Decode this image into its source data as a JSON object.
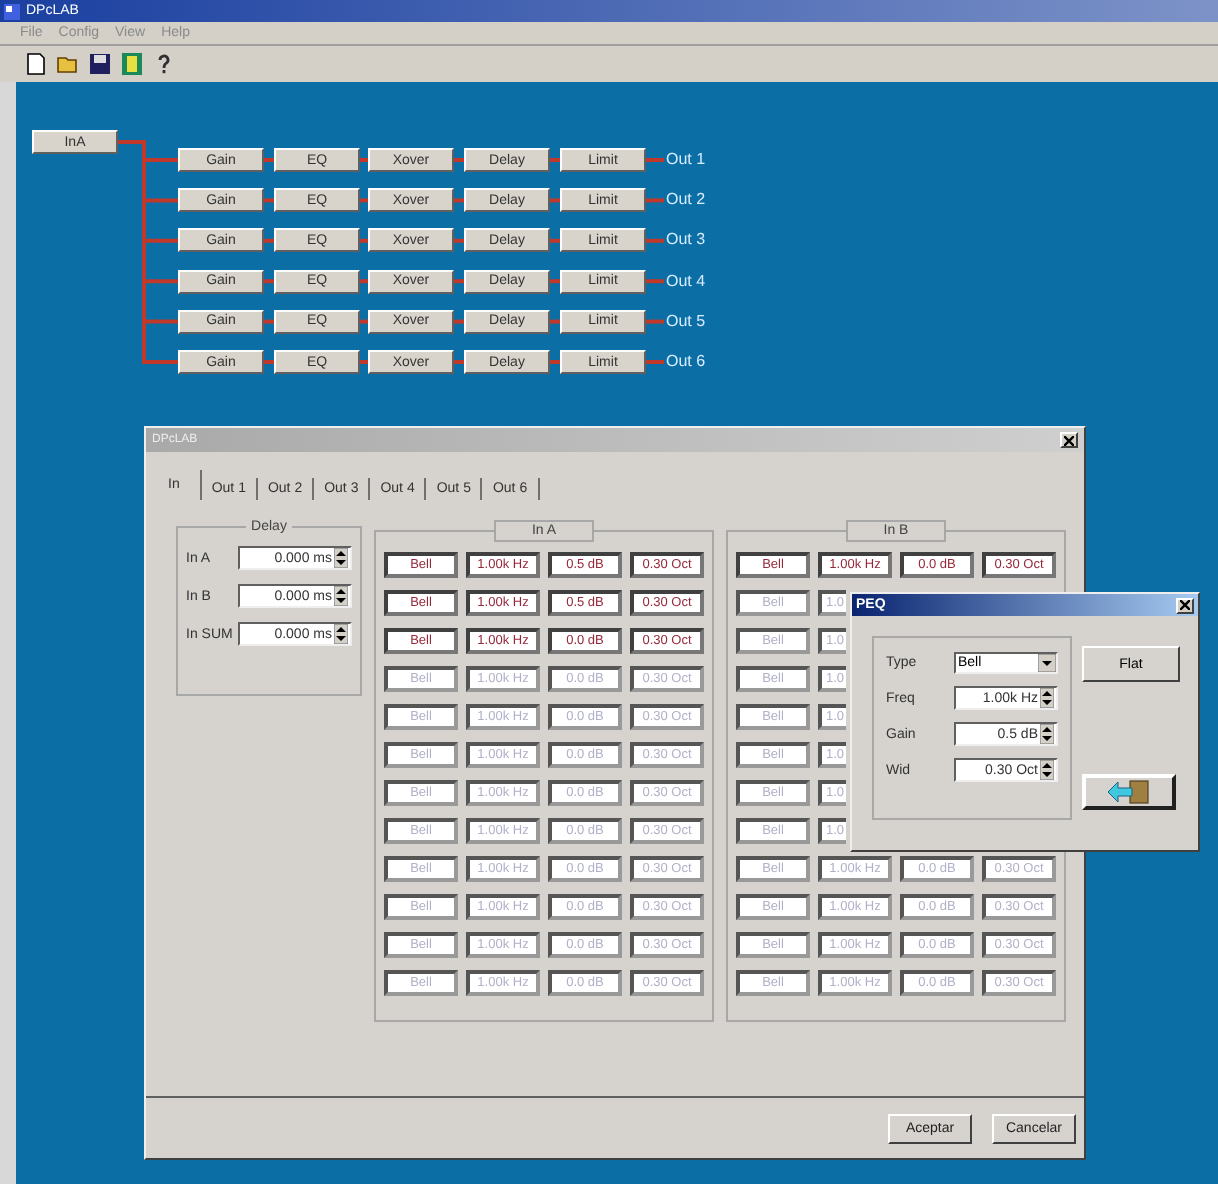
{
  "window": {
    "title": "DPcLAB"
  },
  "menu": [
    "File",
    "Config",
    "View",
    "Help"
  ],
  "diagram": {
    "input": "InA",
    "outputs": [
      {
        "blocks": [
          "Gain",
          "EQ",
          "Xover",
          "Delay",
          "Limit"
        ],
        "label": "Out 1"
      },
      {
        "blocks": [
          "Gain",
          "EQ",
          "Xover",
          "Delay",
          "Limit"
        ],
        "label": "Out 2"
      },
      {
        "blocks": [
          "Gain",
          "EQ",
          "Xover",
          "Delay",
          "Limit"
        ],
        "label": "Out 3"
      },
      {
        "blocks": [
          "Gain",
          "EQ",
          "Xover",
          "Delay",
          "Limit"
        ],
        "label": "Out 4"
      },
      {
        "blocks": [
          "Gain",
          "EQ",
          "Xover",
          "Delay",
          "Limit"
        ],
        "label": "Out 5"
      },
      {
        "blocks": [
          "Gain",
          "EQ",
          "Xover",
          "Delay",
          "Limit"
        ],
        "label": "Out 6"
      }
    ]
  },
  "dialog": {
    "title": "DPcLAB",
    "tabs": [
      {
        "label": "In",
        "selected": true
      },
      {
        "label": "Out 1",
        "selected": false
      },
      {
        "label": "Out 2",
        "selected": false
      },
      {
        "label": "Out 3",
        "selected": false
      },
      {
        "label": "Out 4",
        "selected": false
      },
      {
        "label": "Out 5",
        "selected": false
      },
      {
        "label": "Out 6",
        "selected": false
      }
    ],
    "delay": {
      "title": "Delay",
      "rows": [
        {
          "label": "In A",
          "value": "0.000 ms"
        },
        {
          "label": "In B",
          "value": "0.000 ms"
        },
        {
          "label": "In SUM",
          "value": "0.000 ms"
        }
      ]
    },
    "groups": [
      {
        "title": "In A",
        "rows": [
          {
            "enabled": true,
            "type": "Bell",
            "freq": "1.00k Hz",
            "gain": "0.5 dB",
            "width": "0.30 Oct"
          },
          {
            "enabled": true,
            "type": "Bell",
            "freq": "1.00k Hz",
            "gain": "0.5 dB",
            "width": "0.30 Oct"
          },
          {
            "enabled": true,
            "type": "Bell",
            "freq": "1.00k Hz",
            "gain": "0.0 dB",
            "width": "0.30 Oct"
          },
          {
            "enabled": false,
            "type": "Bell",
            "freq": "1.00k Hz",
            "gain": "0.0 dB",
            "width": "0.30 Oct"
          },
          {
            "enabled": false,
            "type": "Bell",
            "freq": "1.00k Hz",
            "gain": "0.0 dB",
            "width": "0.30 Oct"
          },
          {
            "enabled": false,
            "type": "Bell",
            "freq": "1.00k Hz",
            "gain": "0.0 dB",
            "width": "0.30 Oct"
          },
          {
            "enabled": false,
            "type": "Bell",
            "freq": "1.00k Hz",
            "gain": "0.0 dB",
            "width": "0.30 Oct"
          },
          {
            "enabled": false,
            "type": "Bell",
            "freq": "1.00k Hz",
            "gain": "0.0 dB",
            "width": "0.30 Oct"
          },
          {
            "enabled": false,
            "type": "Bell",
            "freq": "1.00k Hz",
            "gain": "0.0 dB",
            "width": "0.30 Oct"
          },
          {
            "enabled": false,
            "type": "Bell",
            "freq": "1.00k Hz",
            "gain": "0.0 dB",
            "width": "0.30 Oct"
          },
          {
            "enabled": false,
            "type": "Bell",
            "freq": "1.00k Hz",
            "gain": "0.0 dB",
            "width": "0.30 Oct"
          },
          {
            "enabled": false,
            "type": "Bell",
            "freq": "1.00k Hz",
            "gain": "0.0 dB",
            "width": "0.30 Oct"
          }
        ]
      },
      {
        "title": "In B",
        "rows": [
          {
            "enabled": true,
            "type": "Bell",
            "freq": "1.00k Hz",
            "gain": "0.0 dB",
            "width": "0.30 Oct"
          },
          {
            "enabled": false,
            "type": "Bell",
            "freq": "1.0"
          },
          {
            "enabled": false,
            "type": "Bell",
            "freq": "1.0"
          },
          {
            "enabled": false,
            "type": "Bell",
            "freq": "1.0"
          },
          {
            "enabled": false,
            "type": "Bell",
            "freq": "1.0"
          },
          {
            "enabled": false,
            "type": "Bell",
            "freq": "1.0"
          },
          {
            "enabled": false,
            "type": "Bell",
            "freq": "1.0"
          },
          {
            "enabled": false,
            "type": "Bell",
            "freq": "1.0"
          },
          {
            "enabled": false,
            "type": "Bell",
            "freq": "1.00k Hz",
            "gain": "0.0 dB",
            "width": "0.30 Oct"
          },
          {
            "enabled": false,
            "type": "Bell",
            "freq": "1.00k Hz",
            "gain": "0.0 dB",
            "width": "0.30 Oct"
          },
          {
            "enabled": false,
            "type": "Bell",
            "freq": "1.00k Hz",
            "gain": "0.0 dB",
            "width": "0.30 Oct"
          },
          {
            "enabled": false,
            "type": "Bell",
            "freq": "1.00k Hz",
            "gain": "0.0 dB",
            "width": "0.30 Oct"
          }
        ]
      }
    ],
    "buttons": [
      "Aceptar",
      "Cancelar"
    ]
  },
  "peq": {
    "title": "PEQ",
    "type_label": "Type",
    "type_value": "Bell",
    "fields": [
      {
        "label": "Freq",
        "value": "1.00k Hz"
      },
      {
        "label": "Gain",
        "value": "0.5 dB"
      },
      {
        "label": "Wid",
        "value": "0.30 Oct"
      }
    ],
    "flat_button": "Flat"
  }
}
